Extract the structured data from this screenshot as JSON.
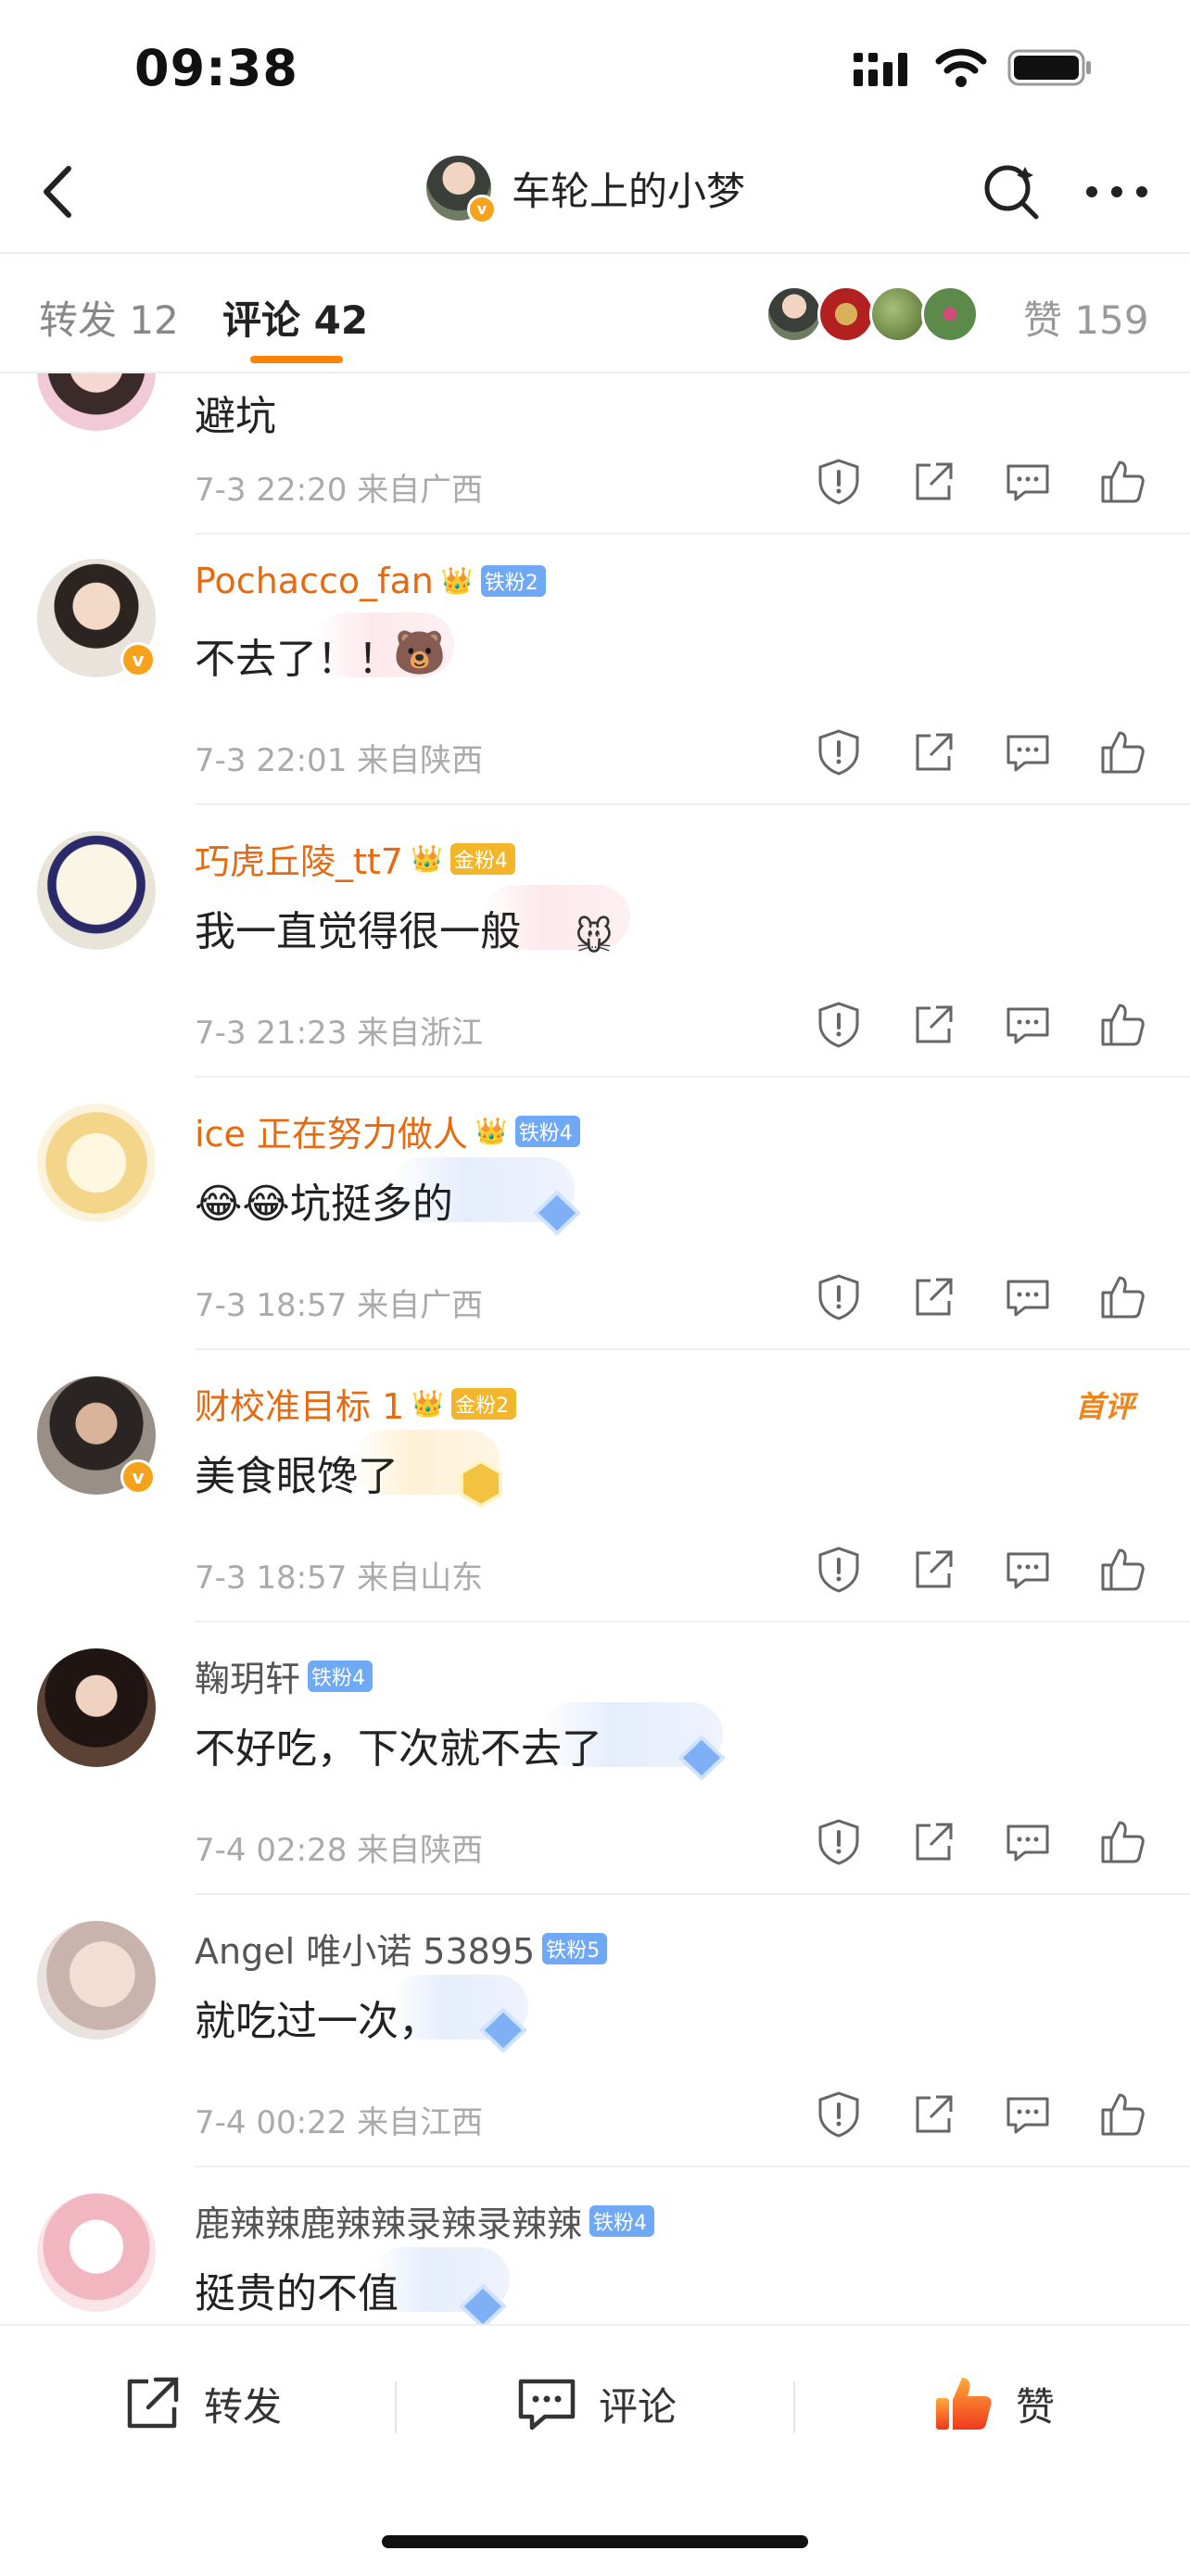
{
  "status_bar": {
    "time": "09:38"
  },
  "nav": {
    "title": "车轮上的小梦"
  },
  "tabs": {
    "repost_label": "转发",
    "repost_count": "12",
    "comment_label": "评论",
    "comment_count": "42",
    "like_label": "赞",
    "like_count": "159"
  },
  "comments": [
    {
      "user": "",
      "fan": "",
      "text": "避坑",
      "time": "7-3 22:20",
      "location": "来自广西"
    },
    {
      "user": "Pochacco_fan",
      "fan": "铁粉2",
      "text": "不去了！！",
      "time": "7-3 22:01",
      "location": "来自陕西"
    },
    {
      "user": "巧虎丘陵_tt7",
      "fan": "金粉4",
      "text": "我一直觉得很一般",
      "time": "7-3 21:23",
      "location": "来自浙江"
    },
    {
      "user": "ice 正在努力做人",
      "fan": "铁粉4",
      "text": "😂😂坑挺多的",
      "time": "7-3 18:57",
      "location": "来自广西"
    },
    {
      "user": "财校准目标 1",
      "fan": "金粉2",
      "text": "美食眼馋了",
      "time": "7-3 18:57",
      "location": "来自山东",
      "tag": "首评"
    },
    {
      "user": "鞠玥轩",
      "fan": "铁粉4",
      "text": "不好吃，下次就不去了",
      "time": "7-4 02:28",
      "location": "来自陕西"
    },
    {
      "user": "Angel 唯小诺 53895",
      "fan": "铁粉5",
      "text": "就吃过一次，",
      "time": "7-4 00:22",
      "location": "来自江西"
    },
    {
      "user": "鹿辣辣鹿辣辣录辣录辣辣",
      "fan": "铁粉4",
      "text": "挺贵的不值",
      "time": "",
      "location": ""
    }
  ],
  "bottom_bar": {
    "repost": "转发",
    "comment": "评论",
    "like": "赞"
  },
  "colors": {
    "accent": "#ff8200",
    "username": "#e86a10",
    "iron_fan": "#6fa8f5",
    "gold_fan": "#f3b52a"
  }
}
